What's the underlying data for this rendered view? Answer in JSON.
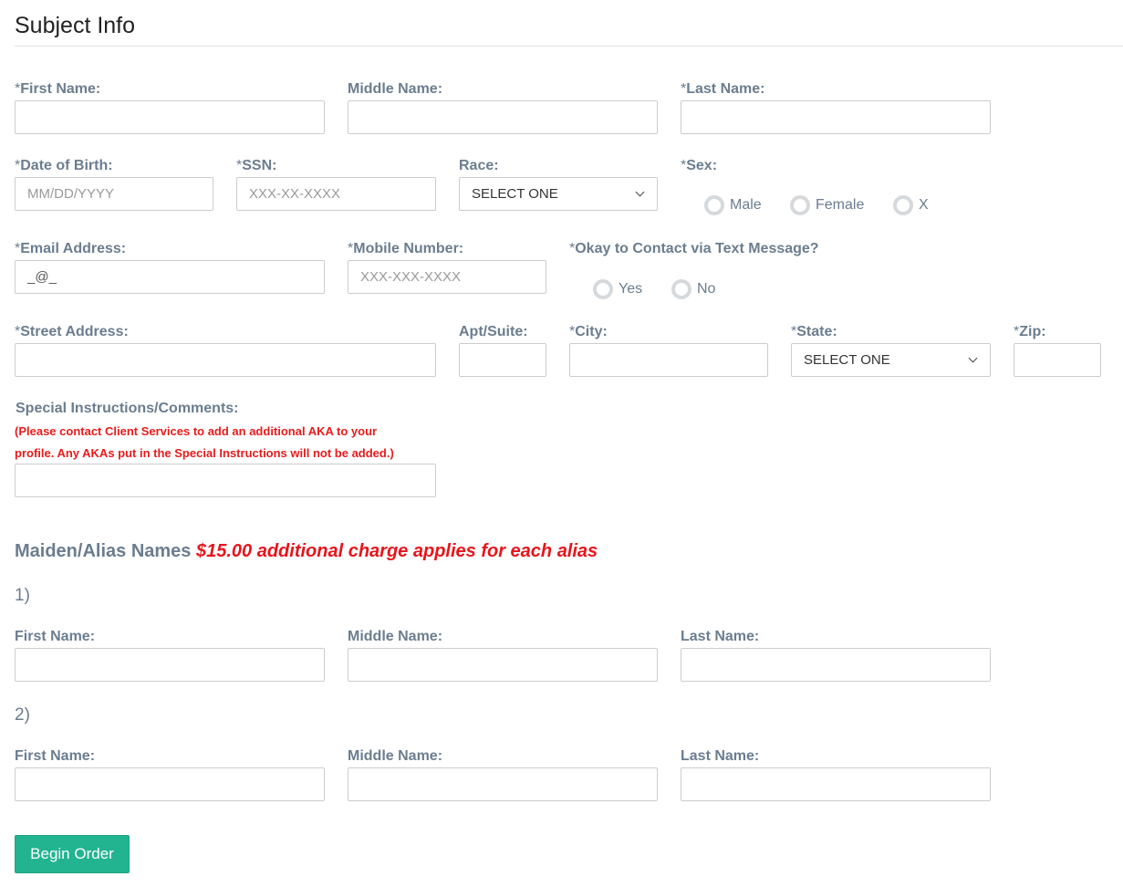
{
  "page": {
    "title": "Subject Info"
  },
  "subject": {
    "first_name": {
      "required": "*",
      "label": "First Name:",
      "value": ""
    },
    "middle_name": {
      "label": "Middle Name:",
      "value": ""
    },
    "last_name": {
      "required": "*",
      "label": "Last Name:",
      "value": ""
    },
    "dob": {
      "required": "*",
      "label": "Date of Birth:",
      "placeholder": "MM/DD/YYYY"
    },
    "ssn": {
      "required": "*",
      "label": "SSN:",
      "placeholder": "XXX-XX-XXXX"
    },
    "race": {
      "label": "Race:",
      "selected": "SELECT ONE"
    },
    "sex": {
      "required": "*",
      "label": "Sex:",
      "options": [
        "Male",
        "Female",
        "X"
      ]
    },
    "email": {
      "required": "*",
      "label": "Email Address:",
      "value": "_@_"
    },
    "mobile": {
      "required": "*",
      "label": "Mobile Number:",
      "placeholder": "XXX-XXX-XXXX"
    },
    "text_ok": {
      "required": "*",
      "label": "Okay to Contact via Text Message?",
      "options": [
        "Yes",
        "No"
      ]
    },
    "street": {
      "required": "*",
      "label": "Street Address:",
      "value": ""
    },
    "apt": {
      "label": "Apt/Suite:",
      "value": ""
    },
    "city": {
      "required": "*",
      "label": "City:",
      "value": ""
    },
    "state": {
      "required": "*",
      "label": "State:",
      "selected": "SELECT ONE"
    },
    "zip": {
      "required": "*",
      "label": "Zip:",
      "value": ""
    },
    "comments": {
      "label": "Special Instructions/Comments:",
      "note_line1": "(Please contact Client Services to add an additional AKA to your",
      "note_line2": "profile. Any AKAs put in the Special Instructions will not be added.)",
      "value": ""
    }
  },
  "aliases": {
    "heading": "Maiden/Alias Names",
    "charge": "$15.00 additional charge applies for each alias",
    "entries": [
      {
        "number": "1)",
        "first_label": "First Name:",
        "middle_label": "Middle Name:",
        "last_label": "Last Name:"
      },
      {
        "number": "2)",
        "first_label": "First Name:",
        "middle_label": "Middle Name:",
        "last_label": "Last Name:"
      }
    ]
  },
  "actions": {
    "begin_order": "Begin Order"
  },
  "colors": {
    "label": "#6b7d8f",
    "required_note": "#e81b1b",
    "button": "#22b491"
  }
}
